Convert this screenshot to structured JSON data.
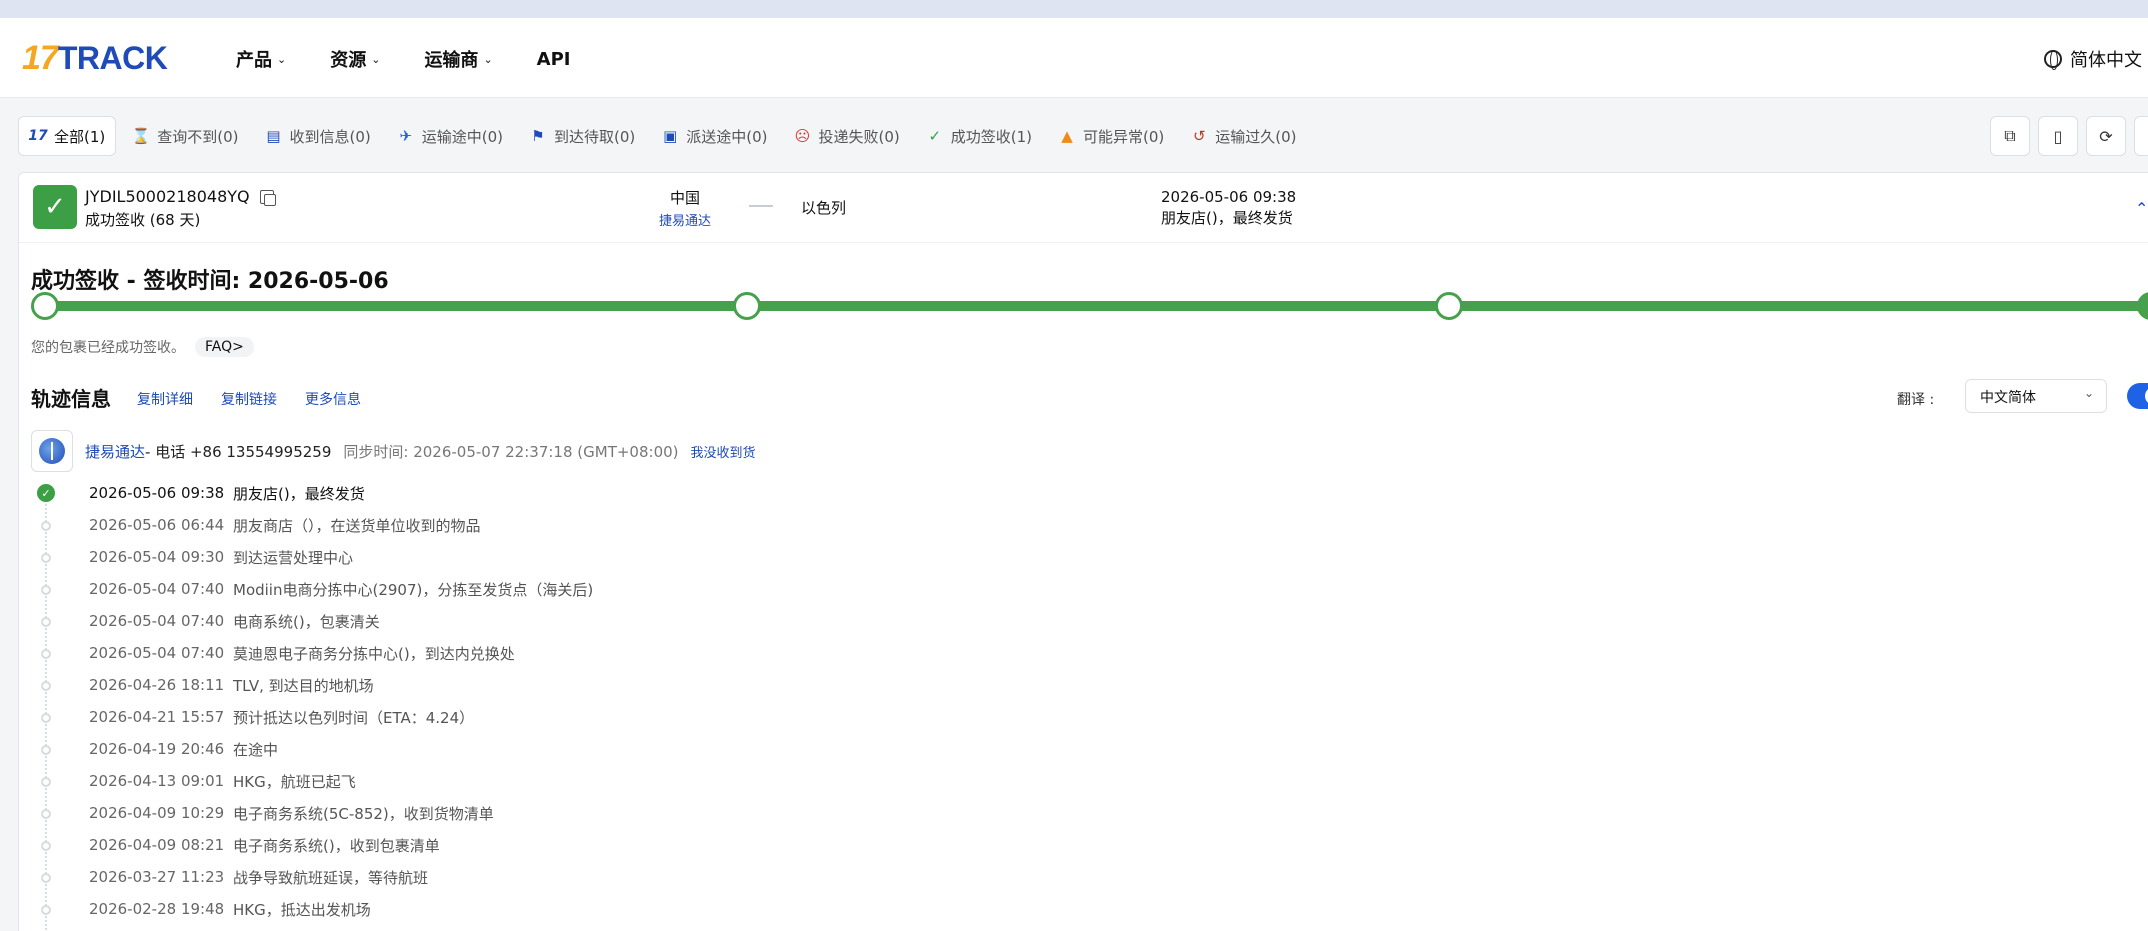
{
  "header": {
    "logo_num": "17",
    "logo_text": "TRACK",
    "nav": [
      {
        "label": "产品",
        "has_dropdown": true
      },
      {
        "label": "资源",
        "has_dropdown": true
      },
      {
        "label": "运输商",
        "has_dropdown": true
      },
      {
        "label": "API",
        "has_dropdown": false
      }
    ],
    "language": "简体中文"
  },
  "filters": [
    {
      "label": "全部(1)",
      "icon": "17-logo-icon",
      "active": true
    },
    {
      "label": "查询不到(0)",
      "icon": "hourglass-icon"
    },
    {
      "label": "收到信息(0)",
      "icon": "info-received-icon"
    },
    {
      "label": "运输途中(0)",
      "icon": "airplane-icon"
    },
    {
      "label": "到达待取(0)",
      "icon": "flag-icon"
    },
    {
      "label": "派送途中(0)",
      "icon": "courier-icon"
    },
    {
      "label": "投递失败(0)",
      "icon": "sad-face-icon"
    },
    {
      "label": "成功签收(1)",
      "icon": "check-icon"
    },
    {
      "label": "可能异常(0)",
      "icon": "warning-icon"
    },
    {
      "label": "运输过久(0)",
      "icon": "clock-history-icon"
    }
  ],
  "shipment": {
    "tracking_number": "JYDIL5000218048YQ",
    "status": "成功签收 (68 天)",
    "origin_country": "中国",
    "carrier": "捷易通达",
    "destination_country": "以色列",
    "latest_time": "2026-05-06 09:38",
    "latest_desc": "朋友店()，最终发货",
    "title": "成功签收 - 签收时间: 2026-05-06",
    "delivered_note": "您的包裹已经成功签收。",
    "faq": "FAQ>",
    "progress_steps_completed": 4
  },
  "track_info": {
    "title": "轨迹信息",
    "links": [
      "复制详细",
      "复制链接",
      "更多信息"
    ],
    "translate_label": "翻译 :",
    "translate_value": "中文简体",
    "translate_on": true
  },
  "carrier_row": {
    "name": "捷易通达",
    "phone": "- 电话 +86 13554995259",
    "sync": "同步时间: 2026-05-07 22:37:18 (GMT+08:00)",
    "not_received": "我没收到货"
  },
  "events": [
    {
      "time": "2026-05-06 09:38",
      "desc": "朋友店()，最终发货"
    },
    {
      "time": "2026-05-06 06:44",
      "desc": "朋友商店（），在送货单位收到的物品"
    },
    {
      "time": "2026-05-04 09:30",
      "desc": "到达运营处理中心"
    },
    {
      "time": "2026-05-04 07:40",
      "desc": "Modiin电商分拣中心(2907)，分拣至发货点（海关后)"
    },
    {
      "time": "2026-05-04 07:40",
      "desc": "电商系统()，包裹清关"
    },
    {
      "time": "2026-05-04 07:40",
      "desc": "莫迪恩电子商务分拣中心()，到达内兑换处"
    },
    {
      "time": "2026-04-26 18:11",
      "desc": "TLV, 到达目的地机场"
    },
    {
      "time": "2026-04-21 15:57",
      "desc": "预计抵达以色列时间（ETA：4.24）"
    },
    {
      "time": "2026-04-19 20:46",
      "desc": "在途中"
    },
    {
      "time": "2026-04-13 09:01",
      "desc": "HKG，航班已起飞"
    },
    {
      "time": "2026-04-09 10:29",
      "desc": "电子商务系统(5C-852)，收到货物清单"
    },
    {
      "time": "2026-04-09 08:21",
      "desc": "电子商务系统()，收到包裹清单"
    },
    {
      "time": "2026-03-27 11:23",
      "desc": "战争导致航班延误，等待航班"
    },
    {
      "time": "2026-02-28 19:48",
      "desc": "HKG，抵达出发机场"
    }
  ],
  "colors": {
    "brand_blue": "#1e4bb8",
    "brand_orange": "#f5a623",
    "success_green": "#47a04b",
    "toggle_blue": "#1e63e6"
  }
}
